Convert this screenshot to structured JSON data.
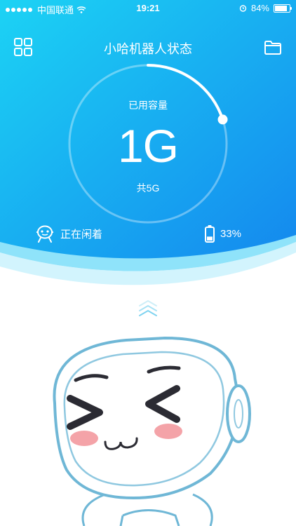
{
  "status_bar": {
    "carrier": "中国联通",
    "time": "19:21",
    "battery": "84%",
    "battery_level": 0.84
  },
  "nav": {
    "title": "小哈机器人状态",
    "left_icon": "grid-menu-icon",
    "right_icon": "folder-icon"
  },
  "storage": {
    "used_label": "已用容量",
    "used_value": "1G",
    "total_label": "共5G",
    "used_fraction": 0.2
  },
  "robot_status": {
    "state": "正在闲着",
    "state_icon": "robot-face-icon",
    "battery_percent": "33%",
    "battery_icon": "battery-icon",
    "battery_level": 0.33
  },
  "colors": {
    "gradient_start": "#1CD0F2",
    "gradient_end": "#128CF0",
    "robot_outline": "#6FB7D6",
    "cheek": "#F4A3A8"
  }
}
